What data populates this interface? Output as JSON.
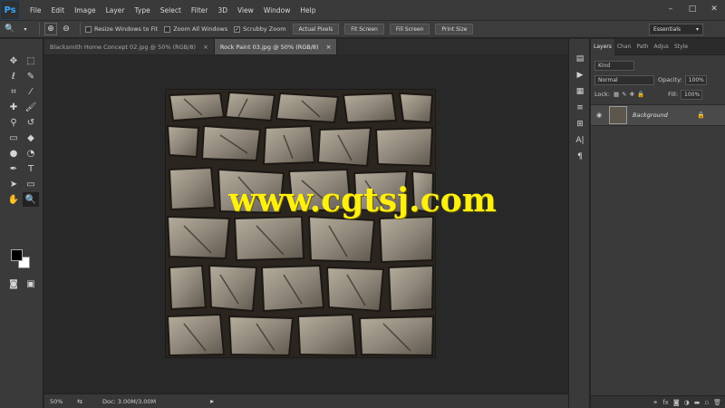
{
  "app": {
    "logo": "Ps"
  },
  "menu": [
    "File",
    "Edit",
    "Image",
    "Layer",
    "Type",
    "Select",
    "Filter",
    "3D",
    "View",
    "Window",
    "Help"
  ],
  "window_buttons": [
    "–",
    "□",
    "✕"
  ],
  "options": {
    "checkboxes": [
      {
        "label": "Resize Windows to Fit",
        "checked": false
      },
      {
        "label": "Zoom All Windows",
        "checked": false
      },
      {
        "label": "Scrubby Zoom",
        "checked": true
      }
    ],
    "buttons": [
      "Actual Pixels",
      "Fit Screen",
      "Fill Screen",
      "Print Size"
    ],
    "workspace": "Essentials"
  },
  "tabs": [
    {
      "label": "Blacksmith Home Concept 02.jpg @ 50% (RGB/8)",
      "active": false
    },
    {
      "label": "Rock Paint 03.jpg @ 50% (RGB/8)",
      "active": true
    }
  ],
  "watermark": "www.cgtsj.com",
  "status": {
    "zoom": "50%",
    "doc": "Doc: 3.00M/3.00M"
  },
  "layers_panel": {
    "tabs": [
      "Layers",
      "Chan",
      "Path",
      "Adjus",
      "Style"
    ],
    "kind": "Kind",
    "blend": "Normal",
    "opacity_label": "Opacity:",
    "opacity": "100%",
    "lock_label": "Lock:",
    "fill_label": "Fill:",
    "fill": "100%",
    "layer_name": "Background"
  }
}
